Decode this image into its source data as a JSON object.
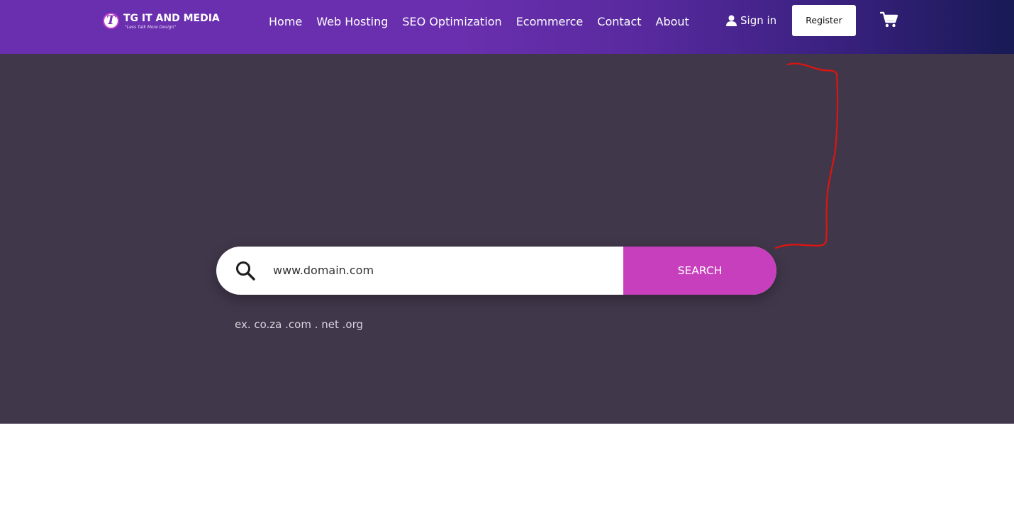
{
  "header": {
    "logo": {
      "letter": "T",
      "title": "TG IT AND MEDIA",
      "tagline": "\"Less Talk More Design\""
    },
    "nav": [
      "Home",
      "Web Hosting",
      "SEO Optimization",
      "Ecommerce",
      "Contact",
      "About"
    ],
    "signin_label": "Sign in",
    "register_label": "Register",
    "icons": {
      "user": "user-icon",
      "cart": "cart-icon"
    }
  },
  "hero": {
    "search": {
      "value": "www.domain.com",
      "button_label": "SEARCH",
      "icon": "search-icon"
    },
    "hint": "ex. co.za .com . net .org"
  },
  "colors": {
    "header_start": "#6a2fae",
    "header_end": "#181a55",
    "hero_bg": "#40374a",
    "search_button": "#c73fbc",
    "annotation_stroke": "#e0140f"
  }
}
